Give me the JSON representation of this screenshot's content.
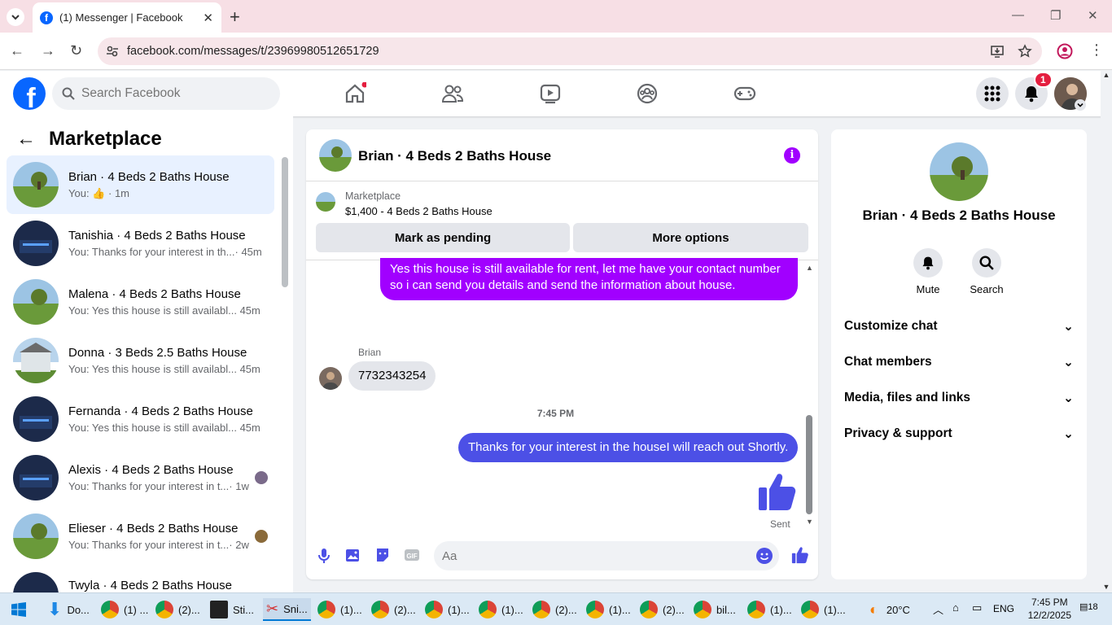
{
  "browser": {
    "tab_title": "(1) Messenger | Facebook",
    "url": "facebook.com/messages/t/23969980512651729"
  },
  "header": {
    "search_placeholder": "Search Facebook",
    "notification_count": "1"
  },
  "sidebar": {
    "title": "Marketplace",
    "conversations": [
      {
        "name": "Brian · 4 Beds 2 Baths House",
        "preview": "You:",
        "time": "· 1m",
        "active": true
      },
      {
        "name": "Tanishia · 4 Beds 2 Baths House",
        "preview": "You: Thanks for your interest in th...",
        "time": "· 45m"
      },
      {
        "name": "Malena · 4 Beds 2 Baths House",
        "preview": "You: Yes this house is still availabl...",
        "time": "45m"
      },
      {
        "name": "Donna · 3 Beds 2.5 Baths House",
        "preview": "You: Yes this house is still availabl...",
        "time": "45m"
      },
      {
        "name": "Fernanda · 4 Beds 2 Baths House",
        "preview": "You: Yes this house is still availabl...",
        "time": "45m"
      },
      {
        "name": "Alexis · 4 Beds 2 Baths House",
        "preview": "You: Thanks for your interest in t...",
        "time": "· 1w"
      },
      {
        "name": "Elieser · 4 Beds 2 Baths House",
        "preview": "You: Thanks for your interest in t...",
        "time": "· 2w"
      },
      {
        "name": "Twyla · 4 Beds 2 Baths House",
        "preview": "",
        "time": ""
      }
    ]
  },
  "chat": {
    "title": "Brian · 4 Beds 2 Baths House",
    "marketplace_label": "Marketplace",
    "listing": "$1,400 - 4 Beds 2 Baths House",
    "mark_pending": "Mark as pending",
    "more_options": "More options",
    "msg1": "Yes this house is still available for rent, let me have your contact number so i can send you details and send the information about house.",
    "sender": "Brian",
    "msg2": "7732343254",
    "timestamp": "7:45 PM",
    "msg3": "Thanks for your interest in the houseI will reach out Shortly.",
    "status": "Sent",
    "composer_placeholder": "Aa"
  },
  "info_panel": {
    "name": "Brian · 4 Beds 2 Baths House",
    "mute": "Mute",
    "search": "Search",
    "sections": [
      "Customize chat",
      "Chat members",
      "Media, files and links",
      "Privacy & support"
    ]
  },
  "taskbar": {
    "items": [
      "Do...",
      "(1) ...",
      "(2)...",
      "Sti...",
      "Sni...",
      "(1)...",
      "(2)...",
      "(1)...",
      "(1)...",
      "(2)...",
      "(1)...",
      "(2)...",
      "bil...",
      "(1)...",
      "(1)..."
    ],
    "temp": "20°C",
    "lang": "ENG",
    "time": "7:45 PM",
    "date": "12/2/2025",
    "notif": "18"
  }
}
